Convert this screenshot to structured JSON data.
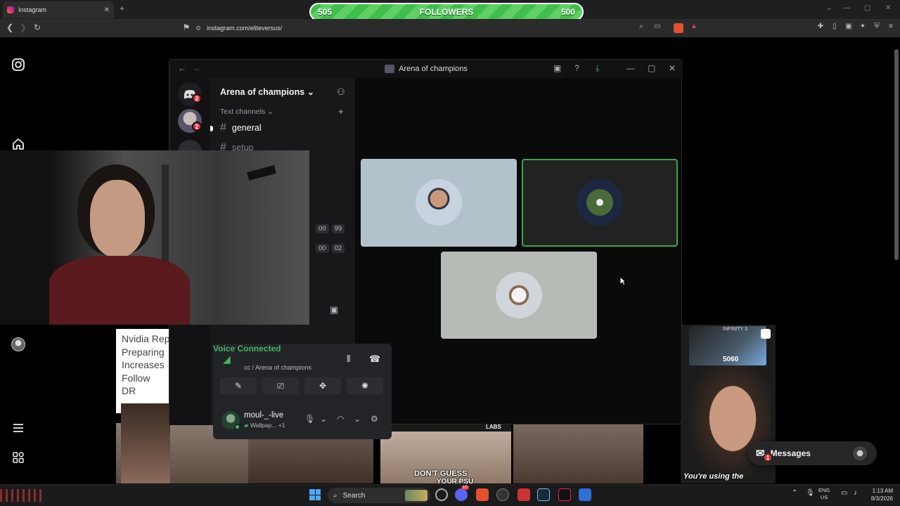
{
  "browser": {
    "tab_title": "Instagram",
    "tab_close": "✕",
    "new_tab": "+",
    "url": "instagram.com/eliteversus/",
    "window_min": "—",
    "window_max": "▢",
    "window_close": "✕"
  },
  "overlay": {
    "followers_current": "505",
    "followers_label": "FOLLOWERS",
    "followers_goal": "500"
  },
  "discord": {
    "window_title": "Arena of champions",
    "server_name": "Arena of champions",
    "server_badge_1": "2",
    "server_badge_2": "2",
    "channel_category": "Text channels",
    "channels": [
      {
        "name": "general"
      },
      {
        "name": "setup"
      }
    ],
    "timers": [
      "00",
      "99",
      "00",
      "02"
    ],
    "voice": {
      "status": "Voice Connected",
      "channel": "cc / Arena of champions"
    },
    "user": {
      "name": "moul-_-live",
      "activity": "Wallpap...",
      "activity_more": "+1"
    }
  },
  "posts": {
    "nvidia_caption": [
      "Nvidia Rep",
      "Preparing",
      "Increases",
      "Follow",
      "DR"
    ],
    "caption_dont_guess": "DON'T GUESS",
    "caption_psu": "YOUR PSU",
    "caption_using": "You're using the",
    "gpu_brand": "INFINITY 3",
    "gpu_model": "5060",
    "labs_tag": "LABS"
  },
  "messages": {
    "label": "Messages",
    "badge": "1"
  },
  "taskbar": {
    "search": "Search",
    "app_badge": "10",
    "lang_top": "ENG",
    "lang_bottom": "US",
    "time": "1:13 AM",
    "date": "8/3/2026"
  },
  "colors": {
    "discord_green": "#43b65d",
    "followers_green": "#3fbf4a",
    "badge_red": "#e0343a",
    "speaking_border": "#3aa54a"
  }
}
